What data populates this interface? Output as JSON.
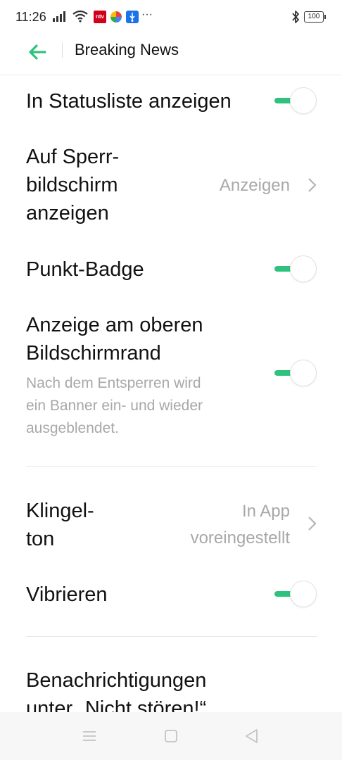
{
  "status_bar": {
    "time": "11:26",
    "battery": "100",
    "icons": [
      "signal-icon",
      "wifi-icon",
      "ntv-app-icon",
      "pinwheel-app-icon",
      "usb-icon",
      "more-dots-icon",
      "bluetooth-icon"
    ],
    "ntv_label": "ntv",
    "more": "···"
  },
  "header": {
    "title": "Breaking News",
    "back_icon": "arrow-left-icon"
  },
  "settings": {
    "status_list": {
      "label": "In Statusliste anzeigen",
      "enabled": true
    },
    "lockscreen": {
      "label_line1": "Auf Sperr-",
      "label_line2": "bildschirm",
      "label_line3": "anzeigen",
      "value": "Anzeigen"
    },
    "dot_badge": {
      "label": "Punkt-Badge",
      "enabled": true
    },
    "top_banner": {
      "label_line1": "Anzeige am oberen",
      "label_line2": "Bildschirmrand",
      "desc_line1": "Nach dem Entsperren wird",
      "desc_line2": "ein Banner ein- und wieder",
      "desc_line3": "ausgeblendet.",
      "enabled": true
    },
    "ringtone": {
      "label_line1": "Klingel-",
      "label_line2": "ton",
      "value_line1": "In App",
      "value_line2": "voreingestellt"
    },
    "vibrate": {
      "label": "Vibrieren",
      "enabled": true
    },
    "dnd": {
      "label_line1": "Benachrichtigungen",
      "label_line2": "unter „Nicht stören!“"
    }
  },
  "colors": {
    "accent": "#2ec27e",
    "secondary_text": "#a8a8a8",
    "divider": "#e8e8e8"
  },
  "nav_bar": {
    "icons": [
      "menu-icon",
      "home-square-icon",
      "back-triangle-icon"
    ]
  }
}
